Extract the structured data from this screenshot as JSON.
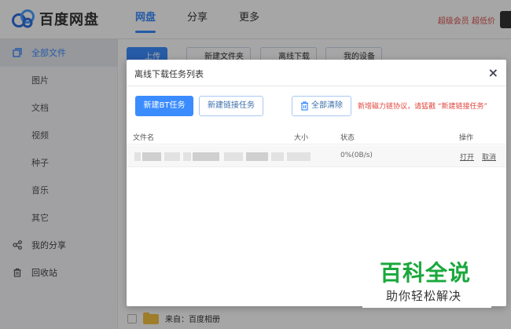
{
  "header": {
    "logo_text": "百度网盘",
    "nav": [
      "网盘",
      "分享",
      "更多"
    ],
    "right_link": "超级会员 超低价"
  },
  "sidebar": {
    "items": [
      {
        "label": "全部文件",
        "icon": "folder-stack-icon"
      },
      {
        "label": "图片"
      },
      {
        "label": "文档"
      },
      {
        "label": "视频"
      },
      {
        "label": "种子"
      },
      {
        "label": "音乐"
      },
      {
        "label": "其它"
      },
      {
        "label": "我的分享",
        "icon": "share-icon"
      },
      {
        "label": "回收站",
        "icon": "trash-icon"
      }
    ]
  },
  "toolbar": {
    "upload": "上传",
    "new_folder": "新建文件夹",
    "offline_download": "离线下载",
    "my_devices": "我的设备"
  },
  "file_list": {
    "bottom_item": "来自：百度相册"
  },
  "dialog": {
    "title": "离线下载任务列表",
    "close": "×",
    "new_bt": "新建BT任务",
    "new_link": "新建链接任务",
    "clear_all": "全部清除",
    "hint": "新增磁力链协议，请猛戳 “新建链接任务”",
    "columns": {
      "name": "文件名",
      "size": "大小",
      "status": "状态",
      "actions": "操作"
    },
    "rows": [
      {
        "status": "0%(0B/s)",
        "open": "打开",
        "cancel": "取消"
      }
    ]
  },
  "watermark": {
    "title": "百科全说",
    "subtitle": "助你轻松解决"
  },
  "colors": {
    "accent": "#3b8cff",
    "hint_red": "#e0463d",
    "watermark_green": "#1aa83c"
  }
}
